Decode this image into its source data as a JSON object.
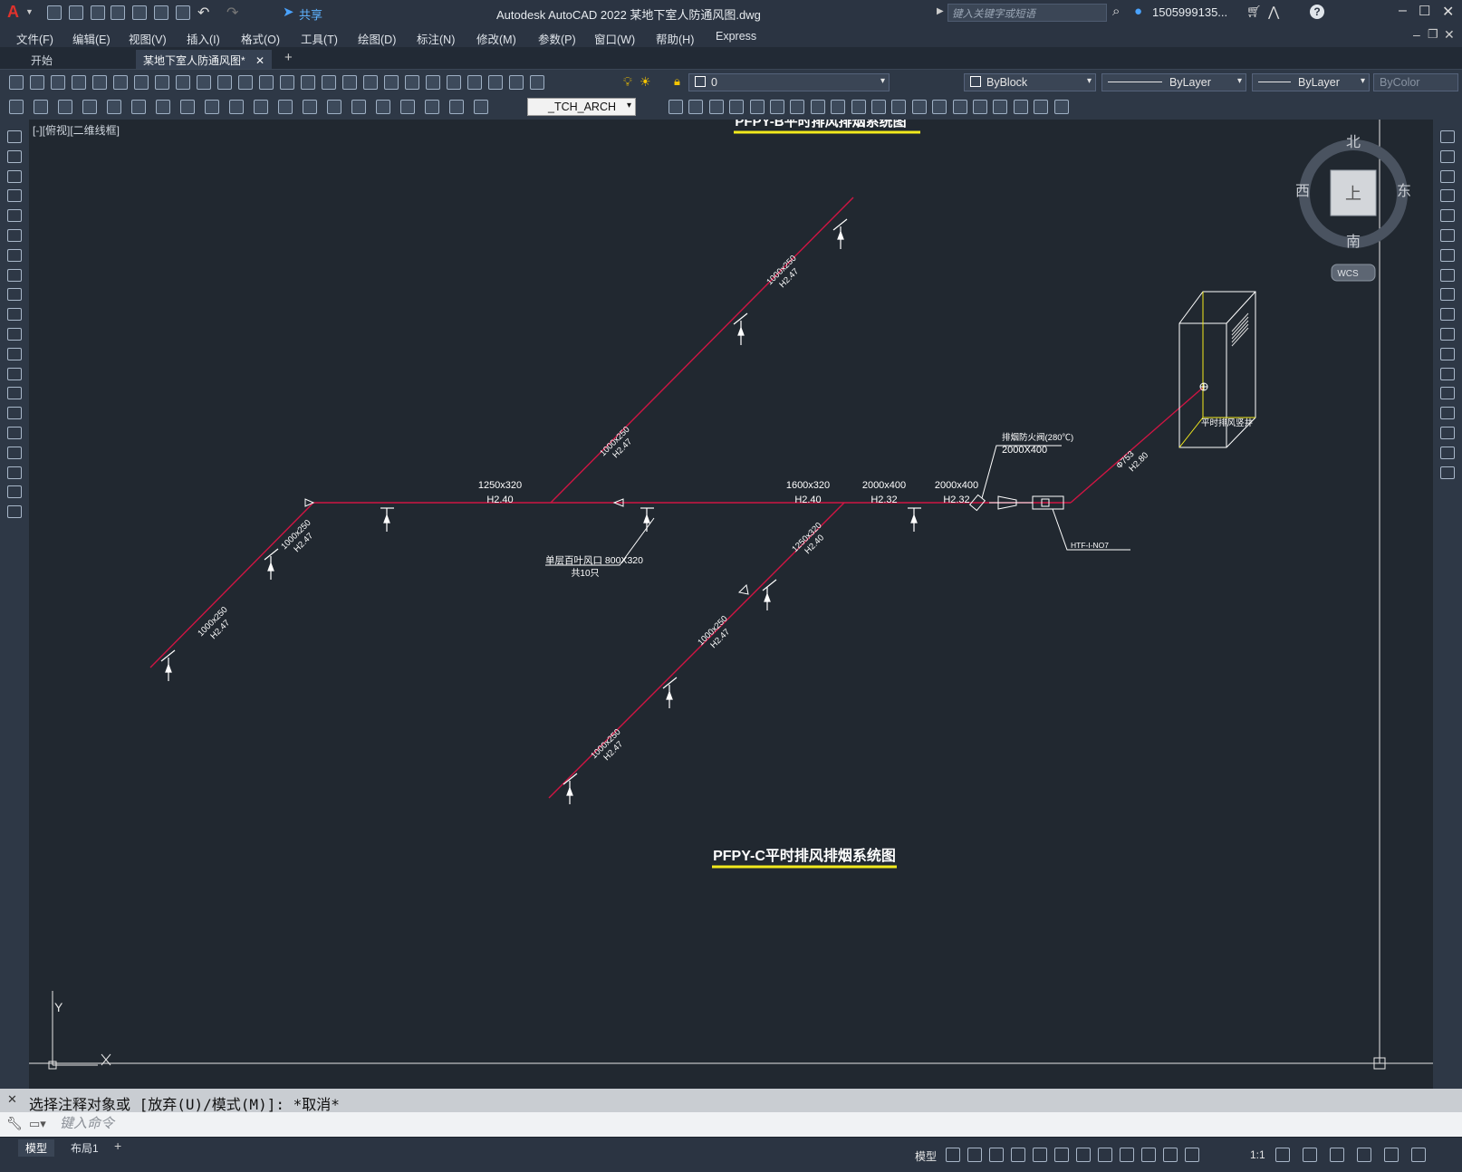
{
  "app": {
    "logo": "A",
    "title": "Autodesk AutoCAD 2022    某地下室人防通风图.dwg",
    "share": "共享",
    "search_placeholder": "键入关键字或短语",
    "user": "1505999135...",
    "window_controls": [
      "minimize-icon",
      "maximize-icon",
      "close-icon"
    ]
  },
  "menu": [
    "文件(F)",
    "编辑(E)",
    "视图(V)",
    "插入(I)",
    "格式(O)",
    "工具(T)",
    "绘图(D)",
    "标注(N)",
    "修改(M)",
    "参数(P)",
    "窗口(W)",
    "帮助(H)",
    "Express"
  ],
  "tabs": [
    {
      "label": "开始",
      "active": false
    },
    {
      "label": "某地下室人防通风图*",
      "active": true
    }
  ],
  "toolbar": {
    "layer": "0",
    "color": "ByBlock",
    "linetype": "ByLayer",
    "lineweight": "ByLayer",
    "plotstyle": "ByColor",
    "dimstyle": "_TCH_ARCH"
  },
  "viewport": {
    "label": "[-][俯视][二维线框]",
    "viewcube": {
      "north": "北",
      "south": "南",
      "east": "东",
      "west": "西",
      "top": "上",
      "wcs": "WCS"
    },
    "ucs": {
      "x": "X",
      "y": "Y"
    }
  },
  "drawing": {
    "title_top": "PFPY-B平时排风排烟系统图",
    "title_bottom": "PFPY-C平时排风排烟系统图",
    "labels": {
      "main_1250": "1250x320",
      "main_1250_h": "H2.40",
      "main_1600": "1600x320",
      "main_1600_h": "H2.40",
      "main_2000a": "2000x400",
      "main_2000a_h": "H2.32",
      "main_2000b": "2000x400",
      "main_2000b_h": "H2.32",
      "branch_top_1": "1000x250",
      "branch_top_1_h": "H2.47",
      "branch_top_2": "1000x250",
      "branch_top_2_h": "H2.47",
      "branch_left_1": "1000x250",
      "branch_left_1_h": "H2.47",
      "branch_left_2": "1000x250",
      "branch_left_2_h": "H2.47",
      "branch_bot_1": "1250x320",
      "branch_bot_1_h": "H2.40",
      "branch_bot_2": "1000x250",
      "branch_bot_2_h": "H2.47",
      "branch_bot_3": "1000x250",
      "branch_bot_3_h": "H2.47",
      "grille_label": "单层百叶风口 800X320",
      "grille_count": "共10只",
      "damper_label": "排烟防火阀(280℃)",
      "damper_size": "2000X400",
      "fan_label": "HTF-I-NO7",
      "riser_size": "Ф753",
      "riser_h": "H2.80",
      "shaft_label": "平时排风竖井"
    }
  },
  "command": {
    "line": "选择注释对象或 [放弃(U)/模式(M)]: *取消*",
    "placeholder": "键入命令"
  },
  "status": {
    "layout_tabs": [
      "模型",
      "布局1"
    ],
    "model": "模型",
    "scale": "1:1"
  },
  "colors": {
    "duct": "#d01543",
    "title_underline": "#f2ea1d",
    "canvas": "#212830",
    "shaft_edge": "#f2ea1d"
  }
}
